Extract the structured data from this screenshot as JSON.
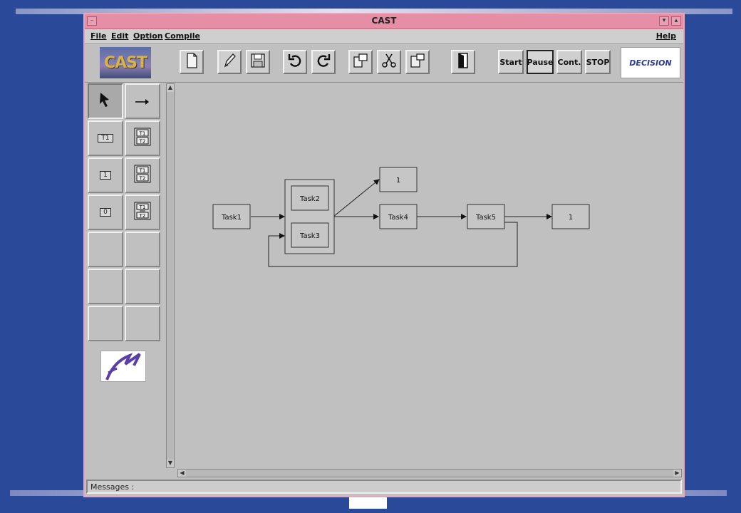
{
  "window": {
    "title": "CAST"
  },
  "menu": {
    "file": "File",
    "edit": "Edit",
    "option": "Option",
    "compile": "Compile",
    "help": "Help"
  },
  "toolbar": {
    "logo_text": "CAST",
    "icons": [
      "new-file-icon",
      "edit-pencil-icon",
      "save-disk-icon",
      "undo-icon",
      "redo-icon",
      "copy-icon",
      "cut-scissors-icon",
      "paste-icon",
      "exit-door-icon"
    ],
    "start": "Start",
    "pause": "Pause",
    "cont": "Cont.",
    "stop": "STOP",
    "decision_logo": "DECISION"
  },
  "palette": {
    "items": [
      {
        "icon": "select-cursor-icon"
      },
      {
        "icon": "arrow-connector-icon"
      },
      {
        "label": "T1"
      },
      {
        "label": "T1 T2",
        "icon": "sequence-block-icon"
      },
      {
        "label": "1"
      },
      {
        "label": "T1 T2",
        "icon": "parallel-block-icon"
      },
      {
        "label": "0"
      },
      {
        "label": "T1 T2",
        "icon": "and-block-icon"
      }
    ]
  },
  "diagram": {
    "nodes": {
      "task1": "Task1",
      "task2": "Task2",
      "task3": "Task3",
      "task4": "Task4",
      "task5": "Task5",
      "out_top": "1",
      "out_right": "1"
    }
  },
  "status": {
    "messages_label": "Messages :"
  }
}
